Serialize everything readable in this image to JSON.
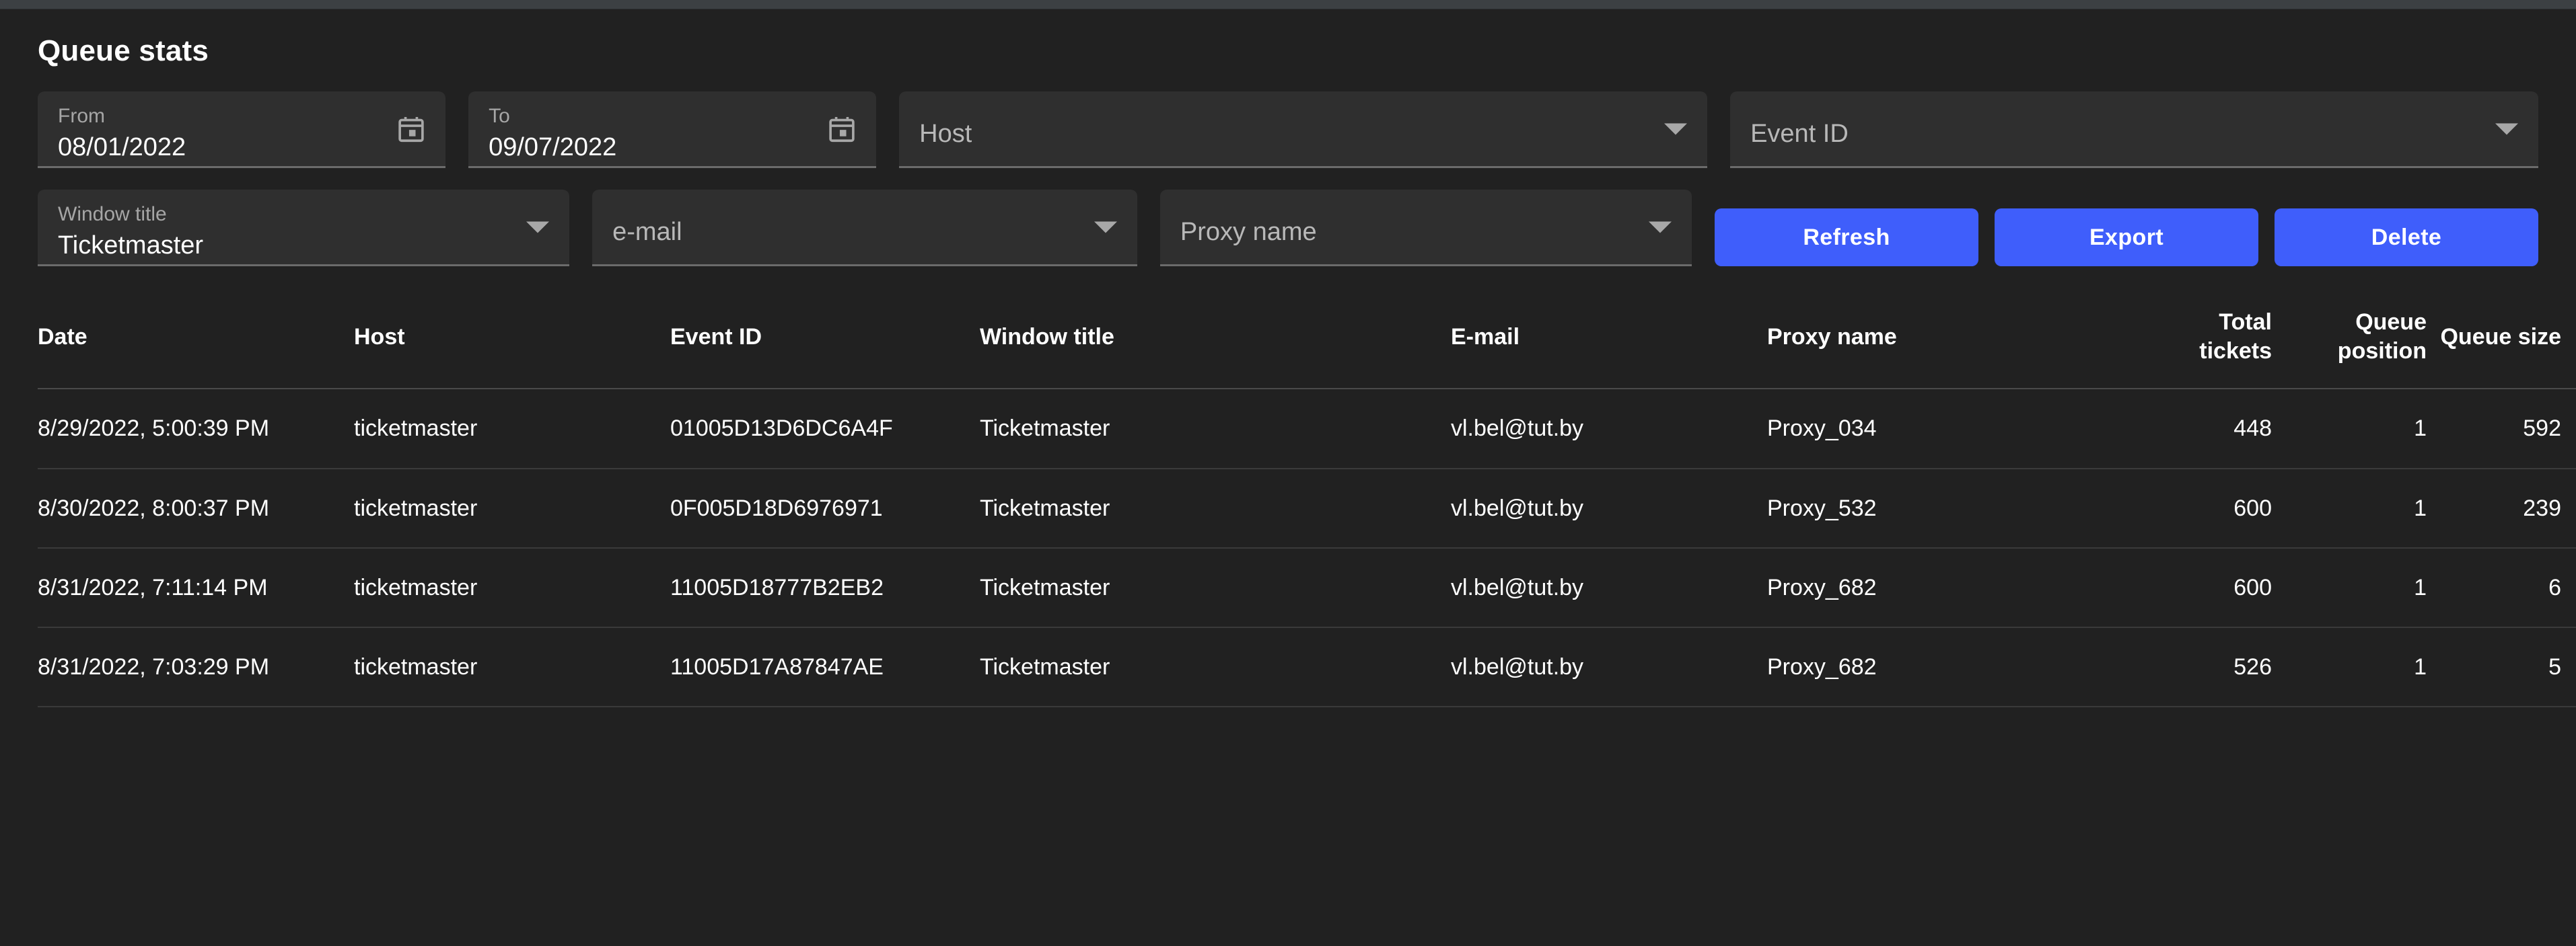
{
  "page": {
    "title": "Queue stats"
  },
  "colors": {
    "background": "#212121",
    "field_background": "#2f2f2f",
    "accent_button": "#3f5efb",
    "text_primary": "#ffffff",
    "text_muted": "#a6a6a6",
    "divider": "#3a3a3a"
  },
  "filters": {
    "from": {
      "label": "From",
      "value": "08/01/2022",
      "icon": "calendar-icon"
    },
    "to": {
      "label": "To",
      "value": "09/07/2022",
      "icon": "calendar-icon"
    },
    "host": {
      "placeholder": "Host",
      "value": "",
      "icon": "chevron-down-icon"
    },
    "event_id": {
      "placeholder": "Event ID",
      "value": "",
      "icon": "chevron-down-icon"
    },
    "window_title": {
      "label": "Window title",
      "value": "Ticketmaster",
      "icon": "chevron-down-icon"
    },
    "email": {
      "placeholder": "e-mail",
      "value": "",
      "icon": "chevron-down-icon"
    },
    "proxy_name": {
      "placeholder": "Proxy name",
      "value": "",
      "icon": "chevron-down-icon"
    }
  },
  "actions": {
    "refresh": "Refresh",
    "export": "Export",
    "delete": "Delete"
  },
  "table": {
    "columns": [
      {
        "key": "date",
        "label": "Date",
        "align": "left"
      },
      {
        "key": "host",
        "label": "Host",
        "align": "left"
      },
      {
        "key": "event_id",
        "label": "Event ID",
        "align": "left"
      },
      {
        "key": "window_title",
        "label": "Window title",
        "align": "left"
      },
      {
        "key": "email",
        "label": "E-mail",
        "align": "left"
      },
      {
        "key": "proxy_name",
        "label": "Proxy name",
        "align": "left"
      },
      {
        "key": "total_tickets",
        "label": "Total tickets",
        "align": "right"
      },
      {
        "key": "queue_position",
        "label": "Queue position",
        "align": "right"
      },
      {
        "key": "queue_size",
        "label": "Queue size",
        "align": "right"
      }
    ],
    "sort": {
      "column": "queue_size",
      "direction": "asc",
      "icon": "arrow-up-icon"
    },
    "rows": [
      {
        "date": "8/29/2022, 5:00:39 PM",
        "host": "ticketmaster",
        "event_id": "01005D13D6DC6A4F",
        "window_title": "Ticketmaster",
        "email": "vl.bel@tut.by",
        "proxy_name": "Proxy_034",
        "total_tickets": "448",
        "queue_position": "1",
        "queue_size": "592"
      },
      {
        "date": "8/30/2022, 8:00:37 PM",
        "host": "ticketmaster",
        "event_id": "0F005D18D6976971",
        "window_title": "Ticketmaster",
        "email": "vl.bel@tut.by",
        "proxy_name": "Proxy_532",
        "total_tickets": "600",
        "queue_position": "1",
        "queue_size": "239"
      },
      {
        "date": "8/31/2022, 7:11:14 PM",
        "host": "ticketmaster",
        "event_id": "11005D18777B2EB2",
        "window_title": "Ticketmaster",
        "email": "vl.bel@tut.by",
        "proxy_name": "Proxy_682",
        "total_tickets": "600",
        "queue_position": "1",
        "queue_size": "6"
      },
      {
        "date": "8/31/2022, 7:03:29 PM",
        "host": "ticketmaster",
        "event_id": "11005D17A87847AE",
        "window_title": "Ticketmaster",
        "email": "vl.bel@tut.by",
        "proxy_name": "Proxy_682",
        "total_tickets": "526",
        "queue_position": "1",
        "queue_size": "5"
      }
    ]
  }
}
